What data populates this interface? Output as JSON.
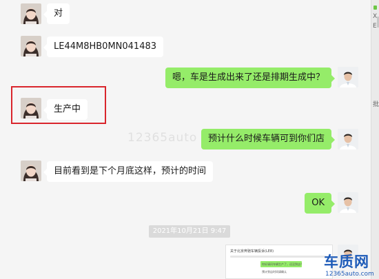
{
  "messages": [
    {
      "side": "left",
      "avatar": "female-avatar",
      "text": "对"
    },
    {
      "side": "left",
      "avatar": "female-avatar",
      "text": "LE44M8HB0MN041483"
    },
    {
      "side": "right",
      "avatar": "male-avatar",
      "text": "嗯，车是生成出来了还是排期生成中？"
    },
    {
      "side": "left",
      "avatar": "female-avatar",
      "text": "生产中"
    },
    {
      "side": "right",
      "avatar": "male-avatar",
      "text": "预计什么时候车辆可到你们店"
    },
    {
      "side": "left",
      "avatar": "female-avatar",
      "text": "目前看到是下个月底这样，预计的时间"
    },
    {
      "side": "right",
      "avatar": "male-avatar",
      "text": "OK"
    }
  ],
  "timestamp": "2021年10月21日 9:47",
  "watermark": "12365auto",
  "attachment": {
    "title": "关于北京奔驰车辆投诉(LE8)",
    "line1": "你好请问车辆生产了，还没到店？",
    "line2": "预计到店时间请确认"
  },
  "brand": {
    "mark": "车质网",
    "domain": "12365auto.com"
  },
  "right_strip": {
    "chars": [
      "X",
      "E",
      "批"
    ]
  },
  "colors": {
    "chat_background": "#f5f5f5",
    "sent_bubble": "#95ec69",
    "received_bubble": "#ffffff",
    "highlight_box": "#d9242b",
    "brand": "#1e5bb8"
  }
}
